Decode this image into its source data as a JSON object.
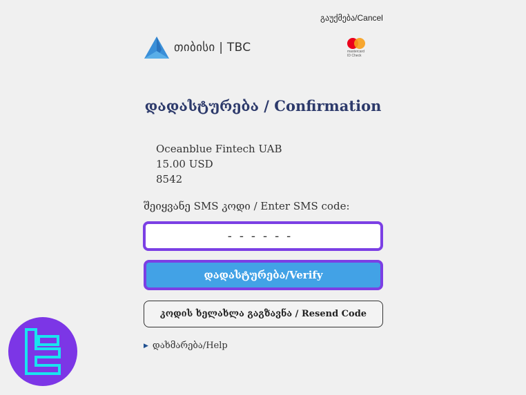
{
  "header": {
    "cancel_label": "გაუქმება/Cancel",
    "bank_name": "თიბისი | TBC",
    "card_scheme_line1": "mastercard",
    "card_scheme_line2": "ID Check"
  },
  "main": {
    "title": "დადასტურება / Confirmation",
    "merchant": "Oceanblue Fintech UAB",
    "amount": "15.00 USD",
    "card_last_digits": "8542",
    "sms_label": "შეიყვანე SMS კოდი / Enter SMS code:",
    "sms_placeholder": "------",
    "verify_label": "დადასტურება/Verify",
    "resend_label": "კოდის ხელახლა გაგზავნა / Resend Code",
    "help_label": "დახმარება/Help"
  },
  "colors": {
    "accent": "#7b3fe4",
    "verify_button": "#42a2e6",
    "title_text": "#2d3a6b",
    "logo_blue": "#3a8fd8",
    "watermark_bg": "#7c36e6",
    "watermark_glyph": "#19e3f0"
  },
  "icons": {
    "bank_logo": "tbc-triangle-logo",
    "card_logo": "mastercard-logo",
    "help_toggle": "triangle-right-icon",
    "watermark": "tradingfinder-logo"
  }
}
